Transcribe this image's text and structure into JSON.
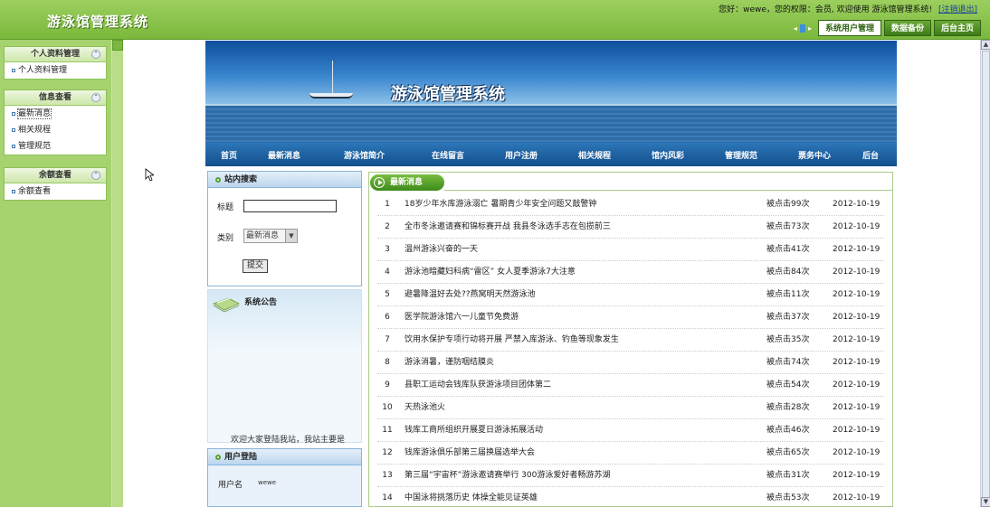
{
  "app": {
    "title": "游泳馆管理系统"
  },
  "header": {
    "welcome_text": "您好：wewe，您的权限：会员, 欢迎使用 游泳馆管理系统!",
    "logout_label": "[注销退出]",
    "buttons": [
      "系统用户管理",
      "数据备份",
      "后台主页"
    ]
  },
  "sidebar": {
    "groups": [
      {
        "title": "个人资料管理",
        "items": [
          "个人资料管理"
        ]
      },
      {
        "title": "信息查看",
        "items": [
          "最新消息",
          "相关规程",
          "管理规范"
        ]
      },
      {
        "title": "余额查看",
        "items": [
          "余额查看"
        ]
      }
    ]
  },
  "banner": {
    "title": "游泳馆管理系统"
  },
  "main_nav": [
    "首页",
    "最新消息",
    "游泳馆简介",
    "在线留言",
    "用户注册",
    "相关规程",
    "馆内风彩",
    "管理规范",
    "票务中心",
    "后台"
  ],
  "search": {
    "title": "站内搜索",
    "title_label": "标题",
    "category_label": "类别",
    "category_selected": "最新消息",
    "submit_label": "提交"
  },
  "notice": {
    "title": "系统公告",
    "scroll_text": "欢迎大家登陆我站，我站主要是"
  },
  "login": {
    "title": "用户登陆",
    "username_label": "用户名",
    "username_value": "wewe"
  },
  "news": {
    "tab_label": "最新消息",
    "rows": [
      {
        "num": "1",
        "title": "18岁少年水库游泳溺亡 暑期青少年安全问题又敲警钟",
        "hits": "被点击99次",
        "date": "2012-10-19"
      },
      {
        "num": "2",
        "title": "全市冬泳邀请赛和锦标赛开战 我县冬泳选手志在包揽前三",
        "hits": "被点击73次",
        "date": "2012-10-19"
      },
      {
        "num": "3",
        "title": "温州游泳兴奋的一天",
        "hits": "被点击41次",
        "date": "2012-10-19"
      },
      {
        "num": "4",
        "title": "游泳池暗藏妇科病“雷区” 女人夏季游泳7大注意",
        "hits": "被点击84次",
        "date": "2012-10-19"
      },
      {
        "num": "5",
        "title": "避暑降温好去处??燕窝明天然游泳池",
        "hits": "被点击11次",
        "date": "2012-10-19"
      },
      {
        "num": "6",
        "title": "医学院游泳馆六一儿童节免费游",
        "hits": "被点击37次",
        "date": "2012-10-19"
      },
      {
        "num": "7",
        "title": "饮用水保护专项行动将开展 严禁入库游泳、钓鱼等现象发生",
        "hits": "被点击35次",
        "date": "2012-10-19"
      },
      {
        "num": "8",
        "title": "游泳消暑，谨防咽结膜炎",
        "hits": "被点击74次",
        "date": "2012-10-19"
      },
      {
        "num": "9",
        "title": "县职工运动会钱库队获游泳项目团体第二",
        "hits": "被点击54次",
        "date": "2012-10-19"
      },
      {
        "num": "10",
        "title": "天热泳池火",
        "hits": "被点击28次",
        "date": "2012-10-19"
      },
      {
        "num": "11",
        "title": "钱库工商所组织开展夏日游泳拓展活动",
        "hits": "被点击46次",
        "date": "2012-10-19"
      },
      {
        "num": "12",
        "title": "钱库游泳俱乐部第三届换届选举大会",
        "hits": "被点击65次",
        "date": "2012-10-19"
      },
      {
        "num": "13",
        "title": "第三届“宇宙杯”游泳邀请赛举行 300游泳爱好者畅游苏湖",
        "hits": "被点击31次",
        "date": "2012-10-19"
      },
      {
        "num": "14",
        "title": "中国泳将挑落历史 体操全能见证英雄",
        "hits": "被点击53次",
        "date": "2012-10-19"
      }
    ]
  }
}
